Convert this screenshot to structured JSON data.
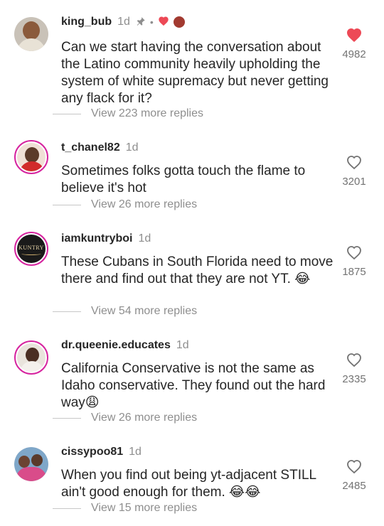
{
  "colors": {
    "liked": "#ed4956",
    "muted": "#8e8e8e",
    "text": "#262626",
    "ring": "#d6249f"
  },
  "comments": [
    {
      "username": "king_bub",
      "time": "1d",
      "pinned_icon": "pin-icon",
      "liked_by_creator": true,
      "body": "Can we start having the conversation about the Latino community heavily upholding the system of white supremacy but never getting any flack for it?",
      "replies": "View 223 more replies",
      "likes": "4982",
      "liked": true
    },
    {
      "username": "t_chanel82",
      "time": "1d",
      "body": "Sometimes folks gotta touch the flame to believe it's hot",
      "replies": "View 26 more replies",
      "likes": "3201",
      "liked": false
    },
    {
      "username": "iamkuntryboi",
      "time": "1d",
      "avatar_text": "KUNTRY",
      "body": "These Cubans in South Florida need to move there and find out that they are not YT. 😂",
      "replies": "View 54 more replies",
      "likes": "1875",
      "liked": false
    },
    {
      "username": "dr.queenie.educates",
      "time": "1d",
      "body": "California Conservative is not the same as Idaho conservative. They found out the hard way😩",
      "replies": "View 26 more replies",
      "likes": "2335",
      "liked": false
    },
    {
      "username": "cissypoo81",
      "time": "1d",
      "body": "When you find out being yt-adjacent STILL ain't good enough for them. 😂😂",
      "replies": "View 15 more replies",
      "likes": "2485",
      "liked": false
    }
  ]
}
